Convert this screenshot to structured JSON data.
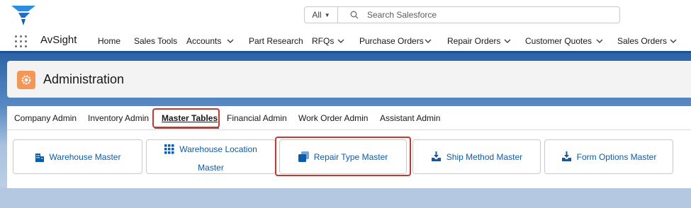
{
  "header": {
    "search": {
      "scope": "All",
      "placeholder": "Search Salesforce"
    }
  },
  "nav": {
    "app_name": "AvSight",
    "items": [
      {
        "label": "Home",
        "has_menu": false
      },
      {
        "label": "Sales Tools",
        "has_menu": false
      },
      {
        "label": "Accounts",
        "has_menu": true
      },
      {
        "label": "Part Research",
        "has_menu": false
      },
      {
        "label": "RFQs",
        "has_menu": true
      },
      {
        "label": "Purchase Orders",
        "has_menu": true
      },
      {
        "label": "Repair Orders",
        "has_menu": true
      },
      {
        "label": "Customer Quotes",
        "has_menu": true
      },
      {
        "label": "Sales Orders",
        "has_menu": true
      }
    ]
  },
  "page": {
    "title": "Administration"
  },
  "tabs": [
    {
      "label": "Company Admin",
      "active": false
    },
    {
      "label": "Inventory Admin",
      "active": false
    },
    {
      "label": "Master Tables",
      "active": true
    },
    {
      "label": "Financial Admin",
      "active": false
    },
    {
      "label": "Work Order Admin",
      "active": false
    },
    {
      "label": "Assistant Admin",
      "active": false
    }
  ],
  "tiles": [
    {
      "label": "Warehouse Master",
      "icon": "building-icon"
    },
    {
      "label_line1": "Warehouse Location",
      "label_line2": "Master",
      "icon": "grid-icon"
    },
    {
      "label": "Repair Type Master",
      "icon": "stacked-squares-icon"
    },
    {
      "label": "Ship Method Master",
      "icon": "inbox-download-icon"
    },
    {
      "label": "Form Options Master",
      "icon": "inbox-download-icon"
    }
  ],
  "colors": {
    "brand_blue": "#1b5297",
    "link_blue": "#0b5cab",
    "admin_icon": "#f49756",
    "highlight_red": "#c23934"
  }
}
